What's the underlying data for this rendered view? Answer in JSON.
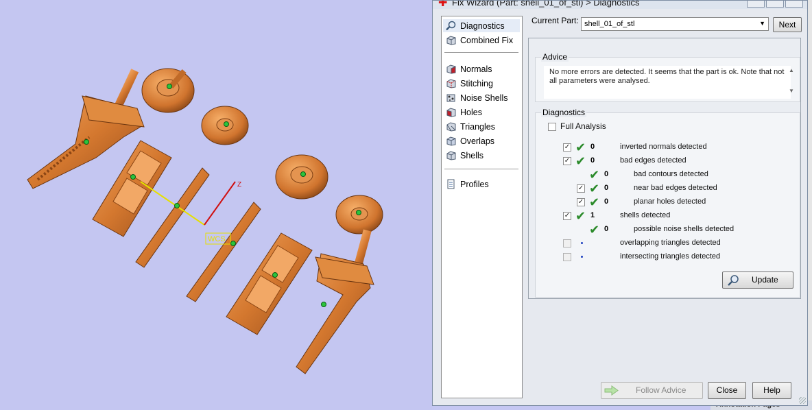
{
  "window": {
    "title": "Fix Wizard (Part: shell_01_of_stl) > Diagnostics"
  },
  "viewport": {
    "wcs_label": "WCS",
    "z_axis_label": "Z"
  },
  "nav": {
    "items": [
      {
        "label": "Diagnostics",
        "icon": "magnifier-icon"
      },
      {
        "label": "Combined Fix",
        "icon": "cube-icon"
      },
      {
        "label": "Normals",
        "icon": "normals-cube-icon"
      },
      {
        "label": "Stitching",
        "icon": "stitching-cube-icon"
      },
      {
        "label": "Noise Shells",
        "icon": "noise-shells-icon"
      },
      {
        "label": "Holes",
        "icon": "holes-cube-icon"
      },
      {
        "label": "Triangles",
        "icon": "triangles-cube-icon"
      },
      {
        "label": "Overlaps",
        "icon": "overlaps-cube-icon"
      },
      {
        "label": "Shells",
        "icon": "shells-cube-icon"
      },
      {
        "label": "Profiles",
        "icon": "document-icon"
      }
    ]
  },
  "current_part": {
    "label": "Current Part:",
    "value": "shell_01_of_stl",
    "next_label": "Next"
  },
  "advice": {
    "group_label": "Advice",
    "text": "No more errors are detected. It seems that the part is ok. Note that not all parameters were analysed."
  },
  "diagnostics": {
    "group_label": "Diagnostics",
    "full_analysis_label": "Full Analysis",
    "rows": [
      {
        "count": "0",
        "desc": "inverted normals detected"
      },
      {
        "count": "0",
        "desc": "bad edges detected"
      },
      {
        "count": "0",
        "desc": "bad contours detected"
      },
      {
        "count": "0",
        "desc": "near bad edges detected"
      },
      {
        "count": "0",
        "desc": "planar holes detected"
      },
      {
        "count": "1",
        "desc": "shells detected"
      },
      {
        "count": "0",
        "desc": "possible noise shells detected"
      },
      {
        "count": "",
        "desc": "overlapping triangles detected"
      },
      {
        "count": "",
        "desc": "intersecting triangles detected"
      }
    ],
    "update_label": "Update"
  },
  "footer": {
    "follow_label": "Follow Advice",
    "close_label": "Close",
    "help_label": "Help"
  },
  "background": {
    "annotation_label": "Annotation Pages"
  }
}
